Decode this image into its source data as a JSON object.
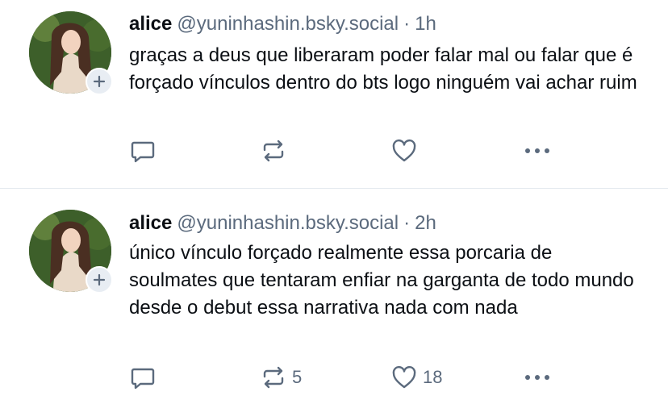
{
  "posts": [
    {
      "author_name": "alice",
      "handle": "@yuninhashin.bsky.social",
      "separator": "·",
      "time": "1h",
      "text": "graças a deus que liberaram poder falar mal ou falar que é forçado vínculos dentro do bts logo ninguém vai achar ruim",
      "reply_count": "",
      "repost_count": "",
      "like_count": ""
    },
    {
      "author_name": "alice",
      "handle": "@yuninhashin.bsky.social",
      "separator": "·",
      "time": "2h",
      "text": "único vínculo forçado realmente essa porcaria de soulmates que tentaram enfiar na garganta de todo mundo desde o debut essa narrativa nada com nada",
      "reply_count": "",
      "repost_count": "5",
      "like_count": "18"
    }
  ],
  "icons": {
    "reply": "speech-bubble-icon",
    "repost": "repost-arrows-icon",
    "like": "heart-icon",
    "more": "ellipsis-icon",
    "follow": "plus-icon"
  },
  "colors": {
    "text": "#0b0f14",
    "muted": "#5b6a7d",
    "divider": "#e3e8ee",
    "badge_bg": "#e8edf3"
  }
}
